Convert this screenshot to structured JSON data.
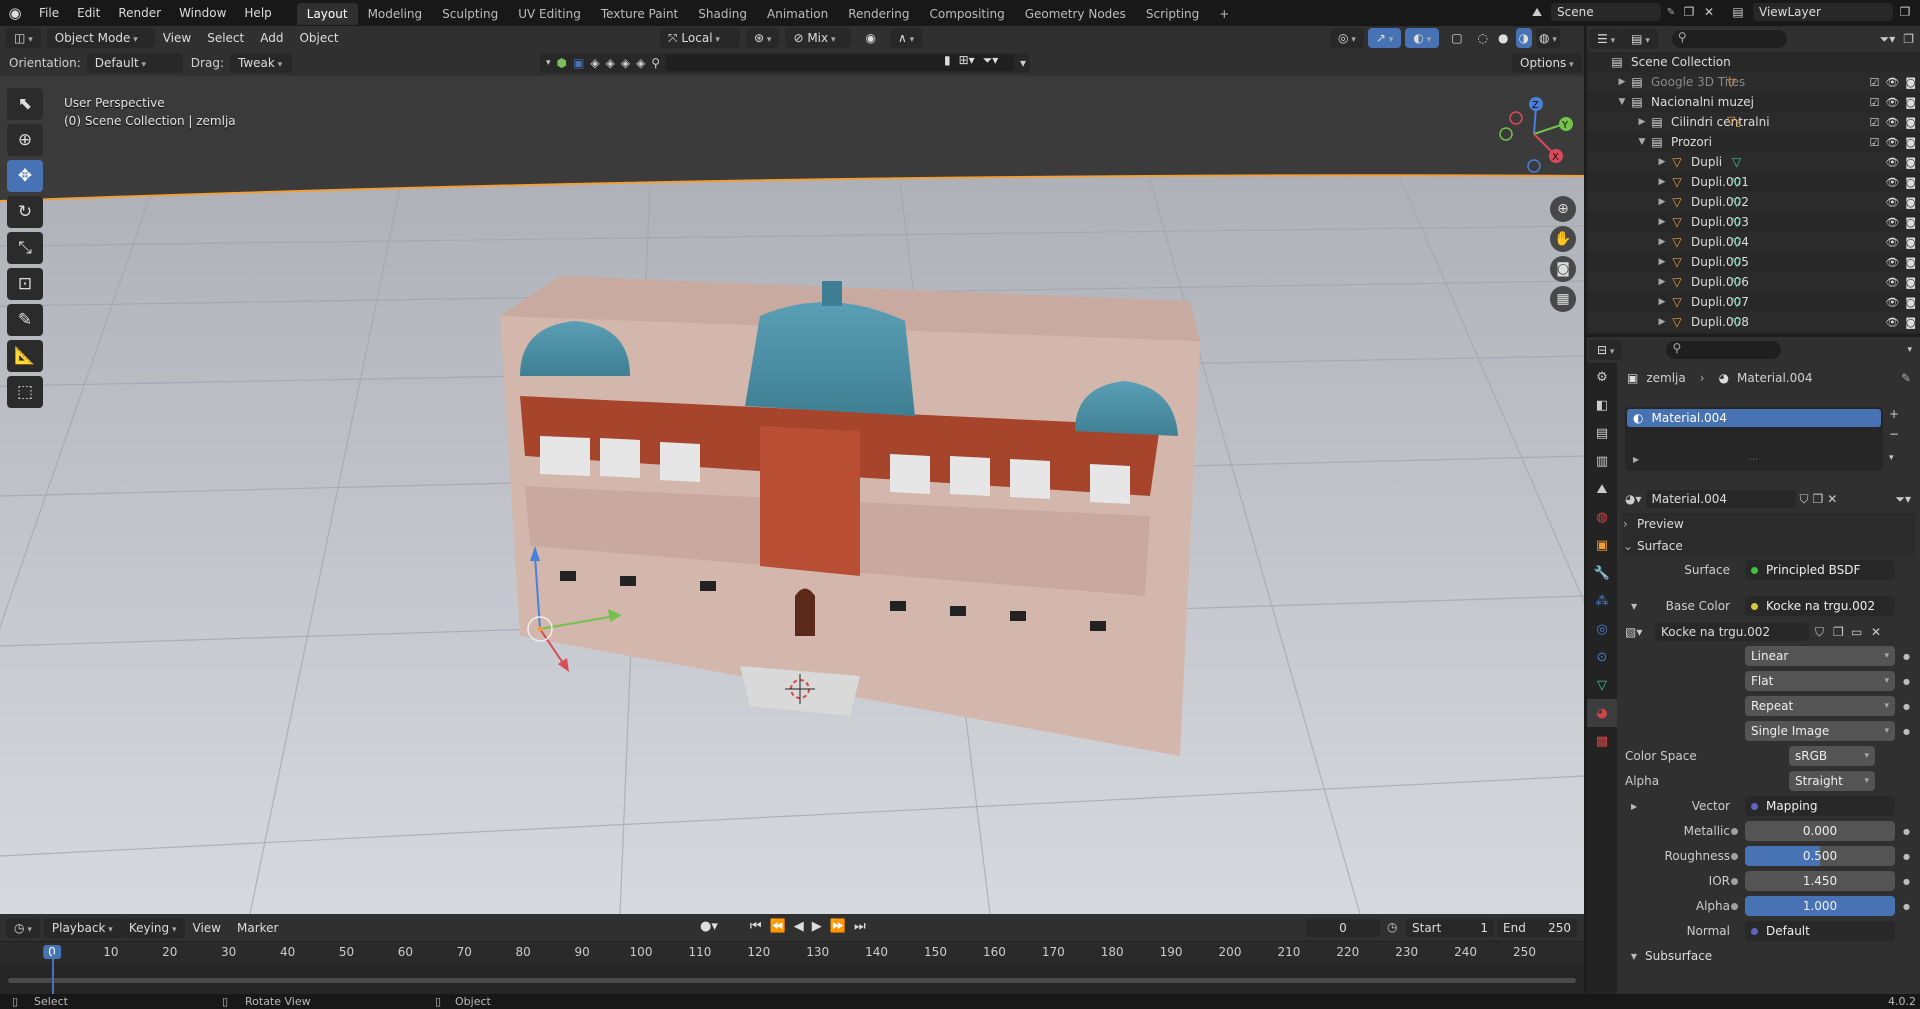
{
  "topbar": {
    "menus": [
      "File",
      "Edit",
      "Render",
      "Window",
      "Help"
    ],
    "workspaces": [
      "Layout",
      "Modeling",
      "Sculpting",
      "UV Editing",
      "Texture Paint",
      "Shading",
      "Animation",
      "Rendering",
      "Compositing",
      "Geometry Nodes",
      "Scripting"
    ],
    "active_workspace": "Layout",
    "add_tab": "+",
    "scene_name": "Scene",
    "view_layer": "ViewLayer"
  },
  "viewport": {
    "header": {
      "mode": "Object Mode",
      "menus": [
        "View",
        "Select",
        "Add",
        "Object"
      ],
      "transform_orientation": "Local",
      "snap_mode": "Mix"
    },
    "header2": {
      "orientation_label": "Orientation:",
      "orientation_value": "Default",
      "drag_label": "Drag:",
      "drag_value": "Tweak",
      "options": "Options"
    },
    "info_line1": "User Perspective",
    "info_line2": "(0) Scene Collection | zemlja",
    "gizmo": {
      "x": "X",
      "y": "Y",
      "z": "Z"
    }
  },
  "timeline": {
    "menus": [
      "Playback",
      "Keying",
      "View",
      "Marker"
    ],
    "current_frame": "0",
    "start_label": "Start",
    "start_value": "1",
    "end_label": "End",
    "end_value": "250",
    "ticks": [
      "0",
      "10",
      "20",
      "30",
      "40",
      "50",
      "60",
      "70",
      "80",
      "90",
      "100",
      "110",
      "120",
      "130",
      "140",
      "150",
      "160",
      "170",
      "180",
      "190",
      "200",
      "210",
      "220",
      "230",
      "240",
      "250"
    ]
  },
  "statusbar": {
    "select": "Select",
    "rotate": "Rotate View",
    "object": "Object",
    "version": "4.0.2"
  },
  "outliner": {
    "rows": [
      {
        "label": "Scene Collection",
        "indent": 0,
        "type": "scene"
      },
      {
        "label": "Google 3D Tiles",
        "indent": 1,
        "type": "collection",
        "dim": true,
        "badge": ""
      },
      {
        "label": "Nacionalni muzej",
        "indent": 1,
        "type": "collection",
        "expanded": true
      },
      {
        "label": "Cilindri centralni",
        "indent": 2,
        "type": "collection",
        "badge": "5"
      },
      {
        "label": "Prozori",
        "indent": 2,
        "type": "collection",
        "expanded": true
      },
      {
        "label": "Dupli",
        "indent": 3,
        "type": "mesh"
      },
      {
        "label": "Dupli.001",
        "indent": 3,
        "type": "mesh"
      },
      {
        "label": "Dupli.002",
        "indent": 3,
        "type": "mesh"
      },
      {
        "label": "Dupli.003",
        "indent": 3,
        "type": "mesh"
      },
      {
        "label": "Dupli.004",
        "indent": 3,
        "type": "mesh"
      },
      {
        "label": "Dupli.005",
        "indent": 3,
        "type": "mesh"
      },
      {
        "label": "Dupli.006",
        "indent": 3,
        "type": "mesh"
      },
      {
        "label": "Dupli.007",
        "indent": 3,
        "type": "mesh"
      },
      {
        "label": "Dupli.008",
        "indent": 3,
        "type": "mesh"
      }
    ]
  },
  "properties": {
    "breadcrumb_object": "zemlja",
    "breadcrumb_material": "Material.004",
    "slot_name": "Material.004",
    "material_name": "Material.004",
    "preview_label": "Preview",
    "surface_section": "Surface",
    "surface_label": "Surface",
    "surface_value": "Principled BSDF",
    "base_color_label": "Base Color",
    "base_color_value": "Kocke na trgu.002",
    "image_name": "Kocke na trgu.002",
    "interpolation": "Linear",
    "projection": "Flat",
    "extension": "Repeat",
    "source": "Single Image",
    "color_space_label": "Color Space",
    "color_space_value": "sRGB",
    "alpha_mode_label": "Alpha",
    "alpha_mode_value": "Straight",
    "vector_label": "Vector",
    "vector_value": "Mapping",
    "metallic_label": "Metallic",
    "metallic_value": "0.000",
    "roughness_label": "Roughness",
    "roughness_value": "0.500",
    "ior_label": "IOR",
    "ior_value": "1.450",
    "alpha_label": "Alpha",
    "alpha_value": "1.000",
    "normal_label": "Normal",
    "normal_value": "Default",
    "subsurface_section": "Subsurface"
  },
  "colors": {
    "accent": "#4772b3",
    "selection_outline": "#f29d38",
    "ground": "#c8ccd2",
    "building": "#d8bdb3",
    "brick": "#a6452c",
    "dome": "#4e8ea6"
  }
}
